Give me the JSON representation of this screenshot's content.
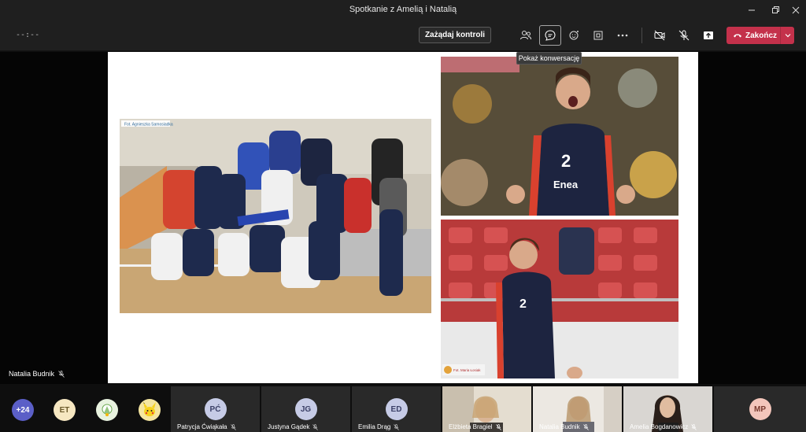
{
  "window": {
    "title": "Spotkanie z Amelią i Natalią"
  },
  "toolbar": {
    "timer": "--:--",
    "request_control_label": "Zażądaj kontroli",
    "end_label": "Zakończ",
    "tooltip": "Pokaż konwersację"
  },
  "stage": {
    "active_speaker": "Natalia Budnik",
    "photo_captions": {
      "team": "Fot. Agnieszka Samosiadka",
      "player": "Fot. Maria Łosiak"
    },
    "jersey_number": "2",
    "sponsor": "Enea"
  },
  "gallery": {
    "overflow_count": "+24",
    "avatars": [
      {
        "initials": "ET",
        "color": "#f6e7c1",
        "text_color": "#6b5a2a"
      },
      {
        "initials": "",
        "icon": "image-avatar-icon",
        "color": "#e8f2df"
      },
      {
        "initials": "",
        "icon": "pikachu-avatar-icon",
        "color": "#f5e6a0"
      }
    ],
    "tiles": [
      {
        "name": "Patrycja Ćwiąkała",
        "initials": "PĆ",
        "type": "avatar"
      },
      {
        "name": "Justyna Gądek",
        "initials": "JG",
        "type": "avatar"
      },
      {
        "name": "Emilia Drąg",
        "initials": "ED",
        "type": "avatar"
      },
      {
        "name": "Elżbieta Bragiel",
        "type": "video"
      },
      {
        "name": "Natalia Budnik",
        "type": "video"
      },
      {
        "name": "Amelia Bogdanowicz",
        "type": "video"
      }
    ],
    "last_avatar": {
      "initials": "MP",
      "color": "#f3c6bb",
      "text_color": "#7a3b2f"
    }
  },
  "colors": {
    "end_button": "#c4314b",
    "overflow_badge": "#5b5fc7"
  }
}
